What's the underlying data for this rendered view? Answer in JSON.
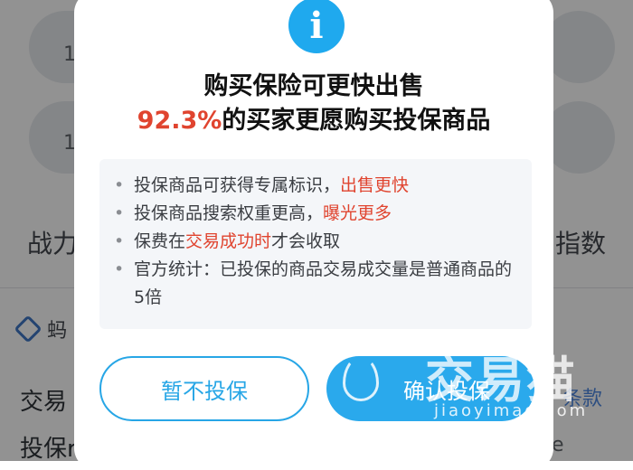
{
  "background": {
    "num_top": "1",
    "num_mid": "1",
    "stat_left": "战力",
    "stat_right": "指数",
    "shop_name": "蚂",
    "row_trade": "交易",
    "row_insure": "投保rd",
    "terms_link": "条款",
    "trailing_char": "e"
  },
  "dialog": {
    "icon": "info-icon",
    "title_line1": "购买保险可更快出售",
    "title_line2_highlight": "92.3%",
    "title_line2_rest": "的买家更愿购买投保商品",
    "benefits": [
      {
        "text": "投保商品可获得专属标识，",
        "highlight": "出售更快",
        "after": ""
      },
      {
        "text": "投保商品搜索权重更高，",
        "highlight": "曝光更多",
        "after": ""
      },
      {
        "text": "保费在",
        "highlight": "交易成功时",
        "after": "才会收取"
      },
      {
        "text": "官方统计：已投保的商品交易成交量是普通商品的5倍",
        "highlight": "",
        "after": ""
      }
    ],
    "cancel_label": "暂不投保",
    "confirm_label": "确认投保"
  },
  "watermark": {
    "main": "交易猫",
    "sub": "jiaoyimao.com"
  },
  "colors": {
    "accent": "#27a6e6",
    "highlight": "#e0442f",
    "icon_bg": "#1fa9ee"
  }
}
